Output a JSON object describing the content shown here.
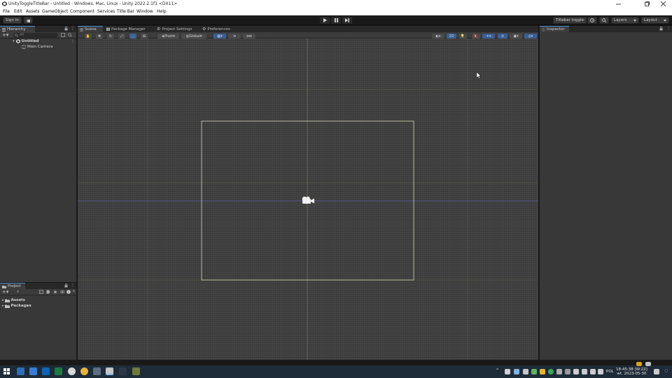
{
  "window": {
    "title": "UnityToggleTitleBar - Untitled - Windows, Mac, Linux - Unity 2022.2.1f1 <DX11>"
  },
  "menubar": {
    "items": [
      "File",
      "Edit",
      "Assets",
      "GameObject",
      "Component",
      "Services",
      "Title Bar",
      "Window",
      "Help"
    ]
  },
  "toolbar": {
    "sign_in": "Sign in",
    "titlebar_toggle": "Titlebar toggle",
    "layers": "Layers",
    "layout": "Layout"
  },
  "hierarchy": {
    "tab": "Hierarchy",
    "search_placeholder": "All",
    "scene_name": "Untitled",
    "items": [
      "Main Camera"
    ]
  },
  "project": {
    "tab": "Project",
    "folders": [
      "Assets",
      "Packages"
    ]
  },
  "scene_tabs": [
    "Scene",
    "Package Manager",
    "Project Settings",
    "Preferences"
  ],
  "scene_toolbar": {
    "pivot": "Pivot",
    "global": "Global",
    "mode_2d": "2D"
  },
  "inspector": {
    "tab": "Inspector"
  },
  "taskbar": {
    "language": "POL",
    "time": "18:45:38 [W:22]",
    "date": "wt. 2023-05-30"
  },
  "colors": {
    "accent_blue": "#4a8bd4",
    "taskbar": "#1e2b38",
    "scene_grid": "#444444",
    "camera_frame": "#d8d7b0"
  }
}
